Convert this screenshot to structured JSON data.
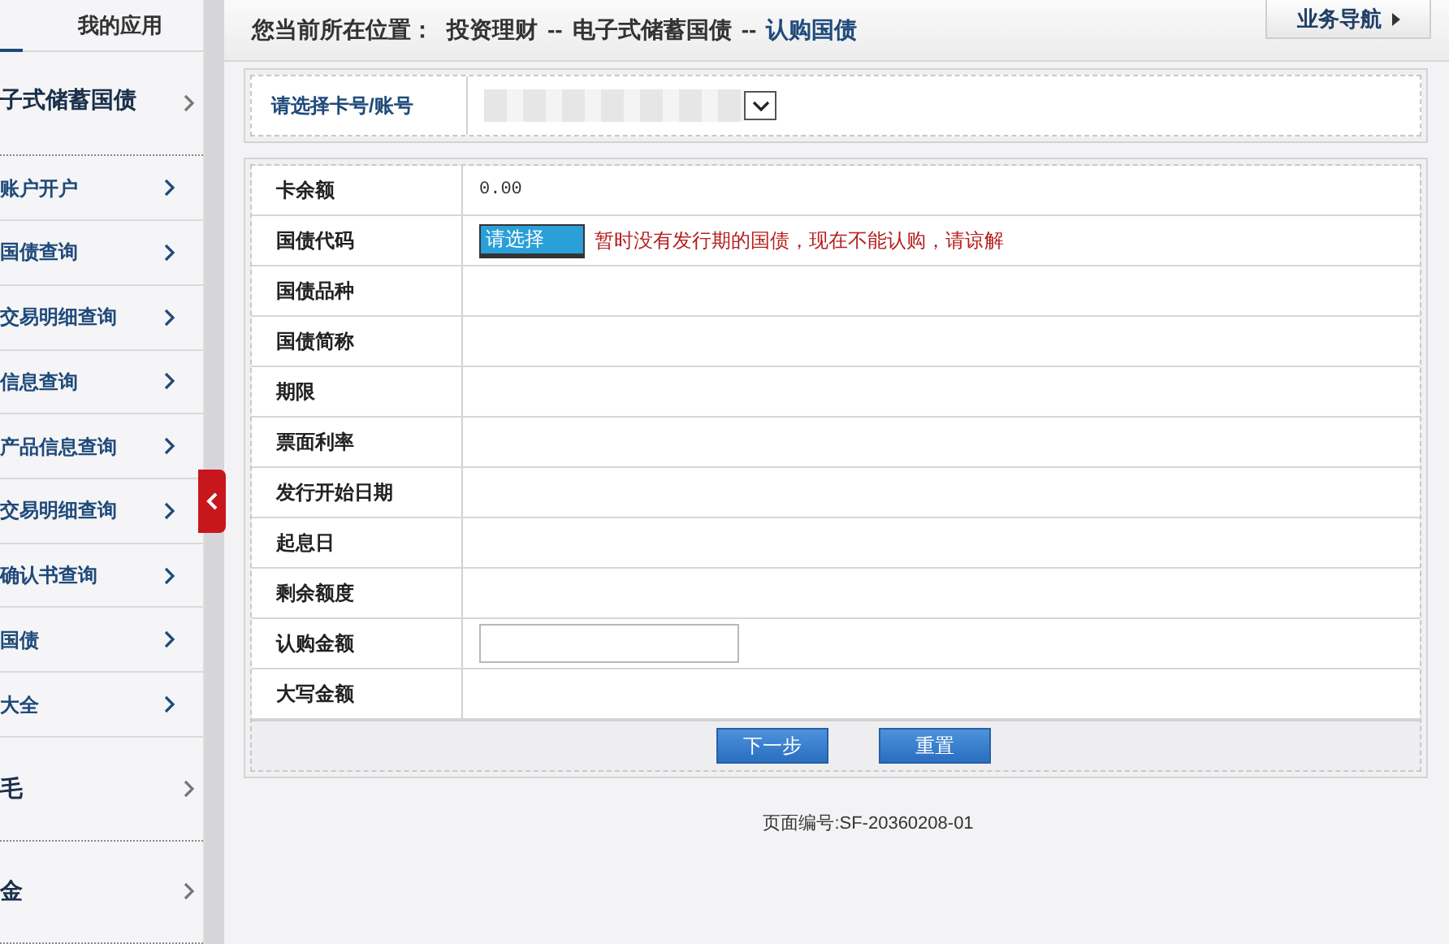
{
  "sidebar": {
    "header": "我的应用",
    "items": [
      {
        "kind": "group",
        "label": "子式储蓄国债"
      },
      {
        "kind": "link",
        "label": "账户开户"
      },
      {
        "kind": "link",
        "label": "国债查询"
      },
      {
        "kind": "link",
        "label": "交易明细查询"
      },
      {
        "kind": "link",
        "label": "信息查询"
      },
      {
        "kind": "link",
        "label": "产品信息查询"
      },
      {
        "kind": "link",
        "label": "交易明细查询"
      },
      {
        "kind": "link",
        "label": "确认书查询"
      },
      {
        "kind": "link",
        "label": "国债"
      },
      {
        "kind": "link",
        "label": "大全"
      },
      {
        "kind": "group",
        "label": "毛"
      },
      {
        "kind": "group",
        "label": "金"
      }
    ]
  },
  "breadcrumb": {
    "prefix": "您当前所在位置：",
    "path": [
      "投资理财",
      "电子式储蓄国债"
    ],
    "separator": "--",
    "current": "认购国债"
  },
  "nav_button": "业务导航",
  "account": {
    "label": "请选择卡号/账号"
  },
  "form": {
    "rows": [
      {
        "kind": "text",
        "label": "卡余额",
        "value": "0.00"
      },
      {
        "kind": "select",
        "label": "国债代码",
        "value": "请选择",
        "message": "暂时没有发行期的国债，现在不能认购，请谅解"
      },
      {
        "kind": "empty",
        "label": "国债品种"
      },
      {
        "kind": "empty",
        "label": "国债简称"
      },
      {
        "kind": "empty",
        "label": "期限"
      },
      {
        "kind": "empty",
        "label": "票面利率"
      },
      {
        "kind": "empty",
        "label": "发行开始日期"
      },
      {
        "kind": "empty",
        "label": "起息日"
      },
      {
        "kind": "empty",
        "label": "剩余额度"
      },
      {
        "kind": "input",
        "label": "认购金额"
      },
      {
        "kind": "empty",
        "label": "大写金额"
      }
    ],
    "buttons": [
      "下一步",
      "重置"
    ]
  },
  "footer": "页面编号:SF-20360208-01"
}
